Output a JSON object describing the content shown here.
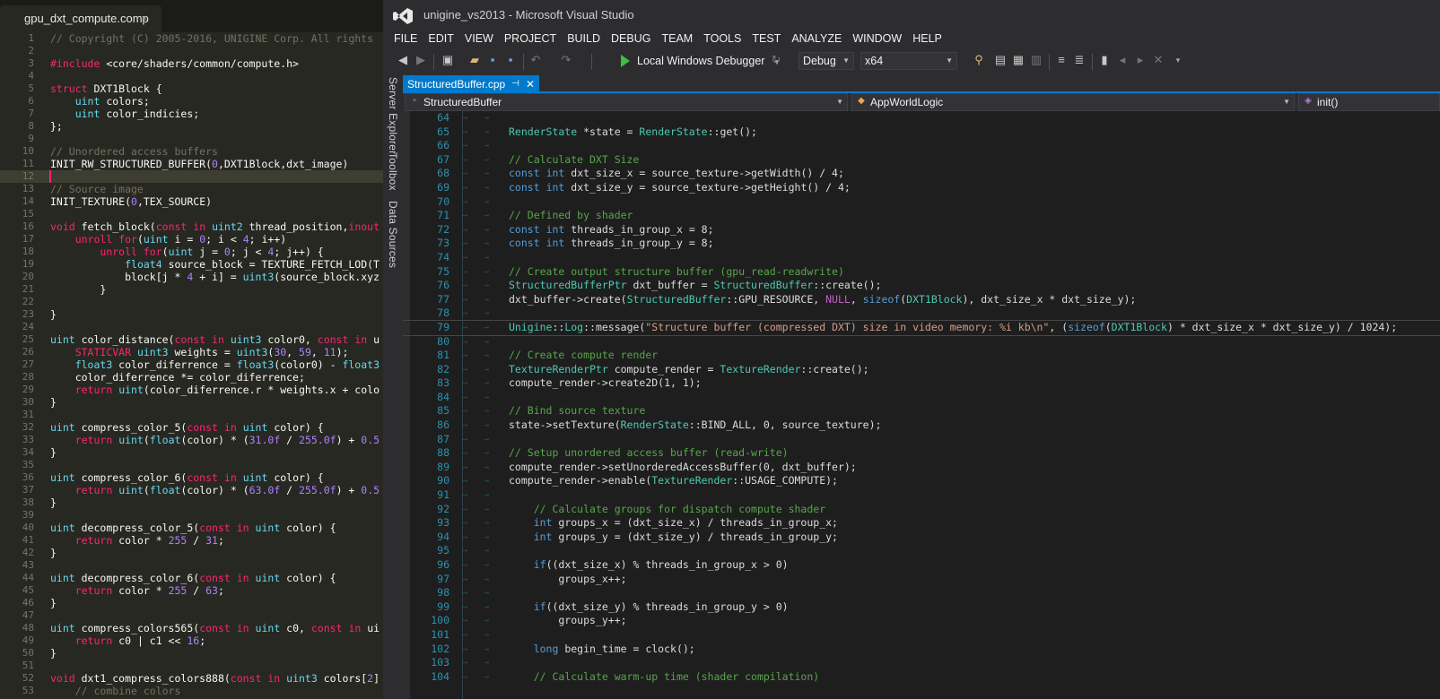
{
  "sublime": {
    "tab": {
      "label": "gpu_dxt_compute.comp",
      "close": "×"
    },
    "lines": [
      {
        "n": "1",
        "t": "// Copyright (C) 2005-2016, UNIGINE Corp. All rights"
      },
      {
        "n": "2",
        "t": ""
      },
      {
        "n": "3",
        "t": "#include <core/shaders/common/compute.h>"
      },
      {
        "n": "4",
        "t": ""
      },
      {
        "n": "5",
        "t": "struct DXT1Block {"
      },
      {
        "n": "6",
        "t": "    uint colors;"
      },
      {
        "n": "7",
        "t": "    uint color_indicies;"
      },
      {
        "n": "8",
        "t": "};"
      },
      {
        "n": "9",
        "t": ""
      },
      {
        "n": "10",
        "t": "// Unordered access buffers"
      },
      {
        "n": "11",
        "t": "INIT_RW_STRUCTURED_BUFFER(0,DXT1Block,dxt_image)"
      },
      {
        "n": "12",
        "t": ""
      },
      {
        "n": "13",
        "t": "// Source image"
      },
      {
        "n": "14",
        "t": "INIT_TEXTURE(0,TEX_SOURCE)"
      },
      {
        "n": "15",
        "t": ""
      },
      {
        "n": "16",
        "t": "void fetch_block(const in uint2 thread_position,inout"
      },
      {
        "n": "17",
        "t": "    unroll for(uint i = 0; i < 4; i++)"
      },
      {
        "n": "18",
        "t": "        unroll for(uint j = 0; j < 4; j++) {"
      },
      {
        "n": "19",
        "t": "            float4 source_block = TEXTURE_FETCH_LOD(T"
      },
      {
        "n": "20",
        "t": "            block[j * 4 + i] = uint3(source_block.xyz"
      },
      {
        "n": "21",
        "t": "        }"
      },
      {
        "n": "22",
        "t": "    "
      },
      {
        "n": "23",
        "t": "}"
      },
      {
        "n": "24",
        "t": ""
      },
      {
        "n": "25",
        "t": "uint color_distance(const in uint3 color0, const in u"
      },
      {
        "n": "26",
        "t": "    STATICVAR uint3 weights = uint3(30, 59, 11);"
      },
      {
        "n": "27",
        "t": "    float3 color_diferrence = float3(color0) - float3"
      },
      {
        "n": "28",
        "t": "    color_diferrence *= color_diferrence;"
      },
      {
        "n": "29",
        "t": "    return uint(color_diferrence.r * weights.x + colo"
      },
      {
        "n": "30",
        "t": "}"
      },
      {
        "n": "31",
        "t": ""
      },
      {
        "n": "32",
        "t": "uint compress_color_5(const in uint color) {"
      },
      {
        "n": "33",
        "t": "    return uint(float(color) * (31.0f / 255.0f) + 0.5"
      },
      {
        "n": "34",
        "t": "}"
      },
      {
        "n": "35",
        "t": ""
      },
      {
        "n": "36",
        "t": "uint compress_color_6(const in uint color) {"
      },
      {
        "n": "37",
        "t": "    return uint(float(color) * (63.0f / 255.0f) + 0.5"
      },
      {
        "n": "38",
        "t": "}"
      },
      {
        "n": "39",
        "t": ""
      },
      {
        "n": "40",
        "t": "uint decompress_color_5(const in uint color) {"
      },
      {
        "n": "41",
        "t": "    return color * 255 / 31;"
      },
      {
        "n": "42",
        "t": "}"
      },
      {
        "n": "43",
        "t": ""
      },
      {
        "n": "44",
        "t": "uint decompress_color_6(const in uint color) {"
      },
      {
        "n": "45",
        "t": "    return color * 255 / 63;"
      },
      {
        "n": "46",
        "t": "}"
      },
      {
        "n": "47",
        "t": ""
      },
      {
        "n": "48",
        "t": "uint compress_colors565(const in uint c0, const in ui"
      },
      {
        "n": "49",
        "t": "    return c0 | c1 << 16;"
      },
      {
        "n": "50",
        "t": "}"
      },
      {
        "n": "51",
        "t": ""
      },
      {
        "n": "52",
        "t": "void dxt1_compress_colors888(const in uint3 colors[2]"
      },
      {
        "n": "53",
        "t": "    // combine colors"
      }
    ]
  },
  "vs": {
    "title": "unigine_vs2013 - Microsoft Visual Studio",
    "menu": [
      "FILE",
      "EDIT",
      "VIEW",
      "PROJECT",
      "BUILD",
      "DEBUG",
      "TEAM",
      "TOOLS",
      "TEST",
      "ANALYZE",
      "WINDOW",
      "HELP"
    ],
    "toolbar": {
      "debugger": "Local Windows Debugger",
      "config": "Debug",
      "platform": "x64"
    },
    "side_tabs": [
      "Server Explorer",
      "Toolbox",
      "Data Sources"
    ],
    "doc_tab": {
      "label": "StructuredBuffer.cpp",
      "pin": "⊣",
      "close": "✕"
    },
    "nav": {
      "scope": "StructuredBuffer",
      "class": "AppWorldLogic",
      "member": "init()"
    },
    "lines": [
      {
        "n": "64",
        "t": ""
      },
      {
        "n": "65",
        "t": "RenderState *state = RenderState::get();"
      },
      {
        "n": "66",
        "t": ""
      },
      {
        "n": "67",
        "t": "// Calculate DXT Size"
      },
      {
        "n": "68",
        "t": "const int dxt_size_x = source_texture->getWidth() / 4;"
      },
      {
        "n": "69",
        "t": "const int dxt_size_y = source_texture->getHeight() / 4;"
      },
      {
        "n": "70",
        "t": ""
      },
      {
        "n": "71",
        "t": "// Defined by shader"
      },
      {
        "n": "72",
        "t": "const int threads_in_group_x = 8;"
      },
      {
        "n": "73",
        "t": "const int threads_in_group_y = 8;"
      },
      {
        "n": "74",
        "t": ""
      },
      {
        "n": "75",
        "t": "// Create output structure buffer (gpu_read-readwrite)"
      },
      {
        "n": "76",
        "t": "StructuredBufferPtr dxt_buffer = StructuredBuffer::create();"
      },
      {
        "n": "77",
        "t": "dxt_buffer->create(StructuredBuffer::GPU_RESOURCE, NULL, sizeof(DXT1Block), dxt_size_x * dxt_size_y);"
      },
      {
        "n": "78",
        "t": ""
      },
      {
        "n": "79",
        "t": "Unigine::Log::message(\"Structure buffer (compressed DXT) size in video memory: %i kb\\n\", (sizeof(DXT1Block) * dxt_size_x * dxt_size_y) / 1024);"
      },
      {
        "n": "80",
        "t": ""
      },
      {
        "n": "81",
        "t": "// Create compute render"
      },
      {
        "n": "82",
        "t": "TextureRenderPtr compute_render = TextureRender::create();"
      },
      {
        "n": "83",
        "t": "compute_render->create2D(1, 1);"
      },
      {
        "n": "84",
        "t": ""
      },
      {
        "n": "85",
        "t": "// Bind source texture"
      },
      {
        "n": "86",
        "t": "state->setTexture(RenderState::BIND_ALL, 0, source_texture);"
      },
      {
        "n": "87",
        "t": ""
      },
      {
        "n": "88",
        "t": "// Setup unordered access buffer (read-write)"
      },
      {
        "n": "89",
        "t": "compute_render->setUnorderedAccessBuffer(0, dxt_buffer);"
      },
      {
        "n": "90",
        "t": "compute_render->enable(TextureRender::USAGE_COMPUTE);"
      },
      {
        "n": "91",
        "t": ""
      },
      {
        "n": "92",
        "t": "    // Calculate groups for dispatch compute shader"
      },
      {
        "n": "93",
        "t": "    int groups_x = (dxt_size_x) / threads_in_group_x;"
      },
      {
        "n": "94",
        "t": "    int groups_y = (dxt_size_y) / threads_in_group_y;"
      },
      {
        "n": "95",
        "t": ""
      },
      {
        "n": "96",
        "t": "    if((dxt_size_x) % threads_in_group_x > 0)"
      },
      {
        "n": "97",
        "t": "        groups_x++;"
      },
      {
        "n": "98",
        "t": ""
      },
      {
        "n": "99",
        "t": "    if((dxt_size_y) % threads_in_group_y > 0)"
      },
      {
        "n": "100",
        "t": "        groups_y++;"
      },
      {
        "n": "101",
        "t": ""
      },
      {
        "n": "102",
        "t": "    long begin_time = clock();"
      },
      {
        "n": "103",
        "t": ""
      },
      {
        "n": "104",
        "t": "    // Calculate warm-up time (shader compilation)"
      }
    ]
  },
  "colors": {
    "accent": "#007acc",
    "keyword": "#569cd6",
    "type": "#4ec9b0",
    "comment": "#57a64a"
  }
}
